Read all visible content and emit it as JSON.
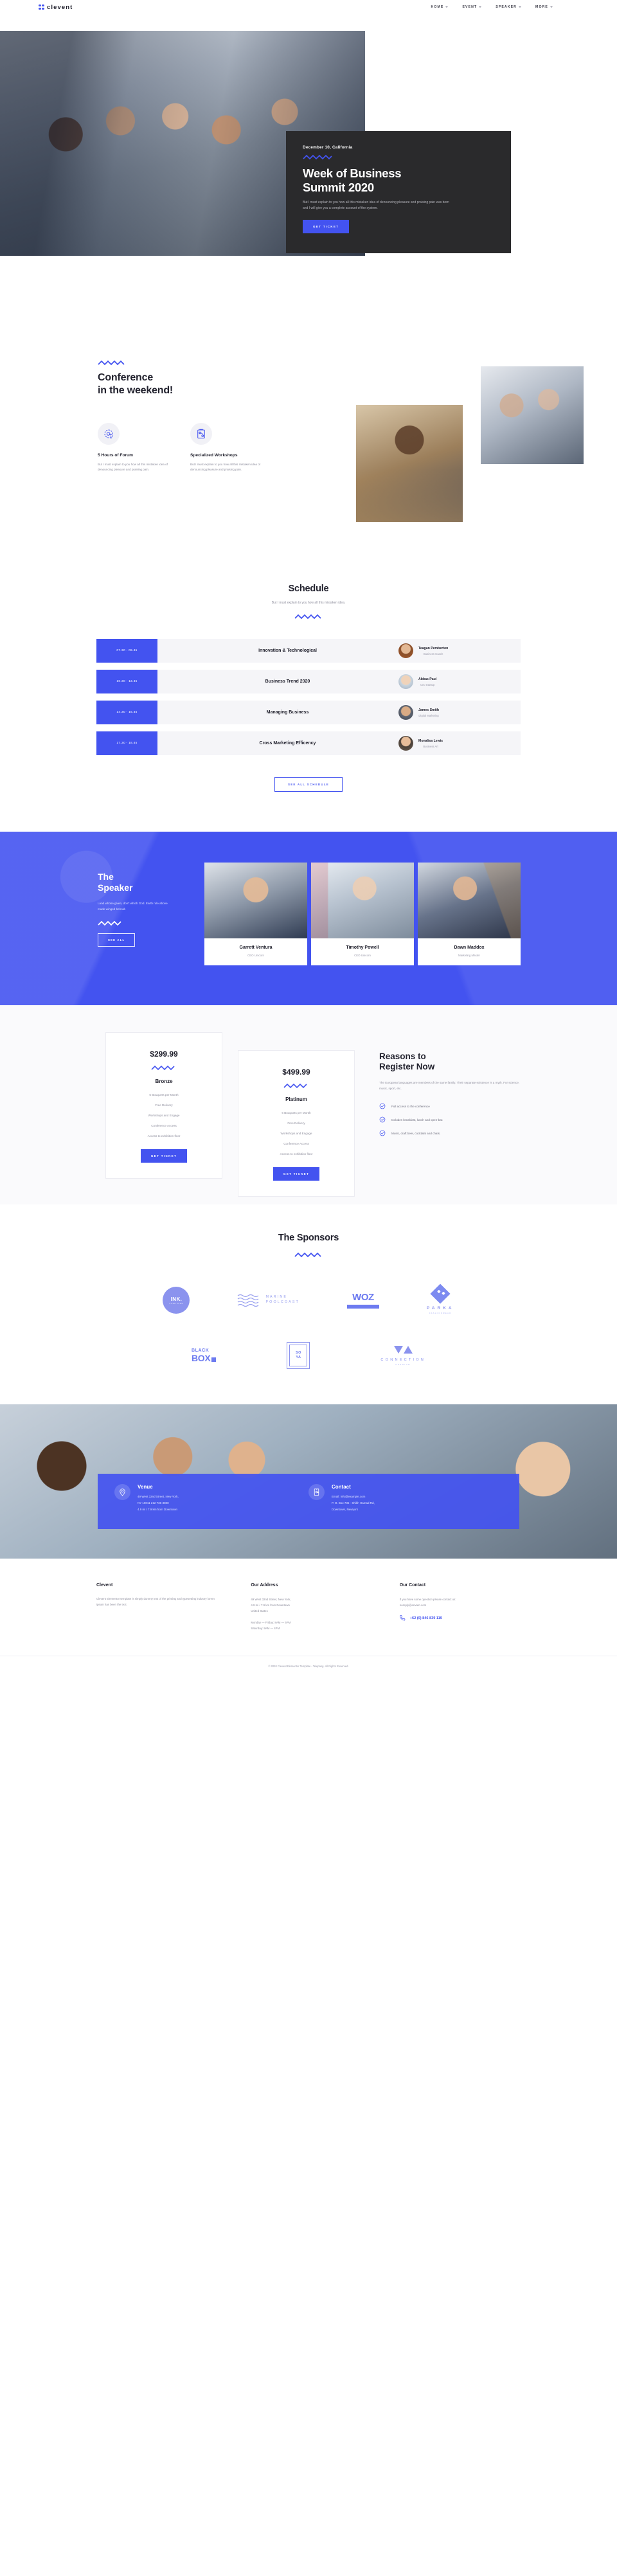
{
  "brand": {
    "name": "clevent",
    "accent": "#4353f0"
  },
  "nav": {
    "items": [
      {
        "label": "HOME",
        "icon": "chevron-down-icon"
      },
      {
        "label": "EVENT",
        "icon": "chevron-down-icon"
      },
      {
        "label": "SPEAKER",
        "icon": "chevron-down-icon"
      },
      {
        "label": "MORE",
        "icon": "chevron-down-icon"
      }
    ]
  },
  "hero": {
    "date": "December 10, California",
    "title_line1": "Week of Business",
    "title_line2": "Summit 2020",
    "description": "But I must explain to you how all this mistaken idea of denouncing pleasure and praising pain was born and I will give you a complete account of the system.",
    "cta": "GET TICKET"
  },
  "conference": {
    "title_line1": "Conference",
    "title_line2": "in the weekend!",
    "features": [
      {
        "icon": "at-chat-icon",
        "title": "5 Hours of Forum",
        "desc": "But I must explain to you how all this mistaken idea of denouncing pleasure and praising pain."
      },
      {
        "icon": "clipboard-strategy-icon",
        "title": "Specialized Workshops",
        "desc": "But I must explain to you how all this mistaken idea of denouncing pleasure and praising pain."
      }
    ]
  },
  "schedule": {
    "title": "Schedule",
    "subtitle": "But I must explain to you how all this mistaken idea.",
    "rows": [
      {
        "time": "07.30 - 09.45",
        "name": "Innovation & Technological",
        "speaker": "Teagan Pemberton",
        "role": "Business Coach"
      },
      {
        "time": "10.30 - 13.45",
        "name": "Business Trend 2020",
        "speaker": "Abbas Paul",
        "role": "Ceo Startup"
      },
      {
        "time": "14.30 - 16.45",
        "name": "Managing Business",
        "speaker": "James Smith",
        "role": "Digital Marketing"
      },
      {
        "time": "17.30 - 18.45",
        "name": "Cross Marketing Efficency",
        "speaker": "Monalisa Lewis",
        "role": "Business Art"
      }
    ],
    "cta": "SEE ALL SCHEDULE"
  },
  "speakers": {
    "title_line1": "The",
    "title_line2": "Speaker",
    "description": "Land whose given, don't which God. Earth rule above made winged behold.",
    "cta": "SEE ALL",
    "cards": [
      {
        "name": "Garrett Ventura",
        "role": "CEO Unicorn"
      },
      {
        "name": "Timothy Powell",
        "role": "CEO Unicorn"
      },
      {
        "name": "Dawn Maddox",
        "role": "Marketing Master"
      }
    ]
  },
  "pricing": {
    "plans": [
      {
        "price": "$299.99",
        "name": "Bronze",
        "features": [
          "6 Bouquets per Month",
          "Free Delivery",
          "Workshops and Engage",
          "Conference Access",
          "Access to exhibition floor"
        ],
        "cta": "GET TICKET"
      },
      {
        "price": "$499.99",
        "name": "Platinum",
        "features": [
          "6 Bouquets per Month",
          "Free Delivery",
          "Workshops and Engage",
          "Conference Access",
          "Access to exhibition floor"
        ],
        "cta": "GET TICKET"
      }
    ],
    "reasons": {
      "title_line1": "Reasons to",
      "title_line2": "Register Now",
      "description": "The European languages are members of the same family. Their separate existence is a myth. For science, music, sport, etc.",
      "items": [
        "Full access to the conference",
        "Includes breakfast, lunch and open-bar.",
        "Music, craft beer, cocktails and chats."
      ],
      "check_icon": "check-circle-icon"
    }
  },
  "sponsors": {
    "title": "The Sponsors",
    "row1": [
      {
        "id": "ink-logo",
        "main": "INK.",
        "sub": "PUBLISHER"
      },
      {
        "id": "marine-poolcoast-logo",
        "line1": "MARINE",
        "line2": "POOLCOAST"
      },
      {
        "id": "woz-logo",
        "main": "WOZ"
      },
      {
        "id": "parka-logo",
        "main": "PARKA",
        "sub": "FASHIONWEAR"
      }
    ],
    "row2": [
      {
        "id": "black-box-logo",
        "line1": "BLACK",
        "line2": "BOX"
      },
      {
        "id": "soya-logo",
        "line1": "SO",
        "line2": "YA"
      },
      {
        "id": "connection-logo",
        "main": "CONNECTION",
        "sub": "PREMIUM"
      }
    ]
  },
  "venue": {
    "venue": {
      "icon": "map-pin-icon",
      "heading": "Venue",
      "lines": [
        "49 West 32nd Street, New York,",
        "NY 10011 212 736-3800",
        "4.9 mi / 7.9 km from Downtown"
      ]
    },
    "contact": {
      "icon": "mobile-mail-icon",
      "heading": "Contact",
      "lines": [
        "Email: info@example.com",
        "P. O. Box 735 - Shikh Hamad Rd,",
        "Downtown, Newyork"
      ]
    }
  },
  "footer": {
    "about": {
      "heading": "Clevent",
      "text": "Clevent Elementor template is simply dummy text of the printing and typesetting industry lorem ipsum has been the text."
    },
    "address": {
      "heading": "Our Address",
      "lines": [
        "49 West 32nd Street, New York,",
        "4.9 mi / 7.9 km from Downtown",
        "United States"
      ],
      "hours": [
        "Monday — Friday: 8AM — 6PM",
        "Saturday: 9AM — 4PM"
      ]
    },
    "contact": {
      "heading": "Our Contact",
      "text": "If you have some question please contact us:",
      "email": "noreply@envato.com",
      "phone_icon": "phone-icon",
      "phone": "+62 (0) 846 839 119"
    },
    "copyright": "© 2020 Clevent Elementor Template - Telepang. All Rights Reserved."
  }
}
